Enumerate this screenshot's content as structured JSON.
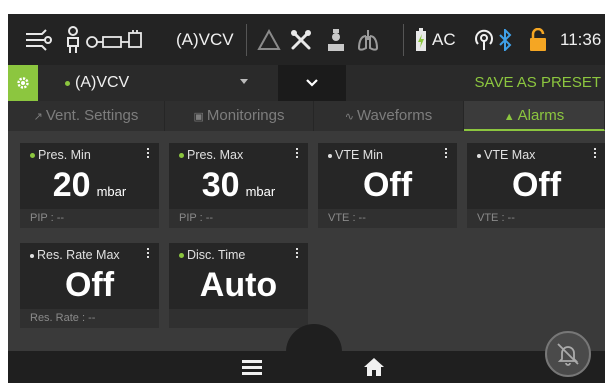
{
  "status": {
    "mode": "(A)VCV",
    "power": "AC",
    "time": "11:36"
  },
  "moderow": {
    "mode_label": "(A)VCV",
    "save_preset": "SAVE AS PRESET"
  },
  "tabs": [
    {
      "label": "Vent. Settings",
      "icon": "wrench-icon"
    },
    {
      "label": "Monitorings",
      "icon": "monitor-icon"
    },
    {
      "label": "Waveforms",
      "icon": "wave-icon"
    },
    {
      "label": "Alarms",
      "icon": "bell-icon"
    }
  ],
  "active_tab": "Alarms",
  "cards": [
    {
      "title": "Pres. Min",
      "value": "20",
      "unit": "mbar",
      "sub": "PIP : --",
      "dot": "green"
    },
    {
      "title": "Pres. Max",
      "value": "30",
      "unit": "mbar",
      "sub": "PIP : --",
      "dot": "green"
    },
    {
      "title": "VTE Min",
      "value": "Off",
      "unit": "",
      "sub": "VTE : --",
      "dot": "white"
    },
    {
      "title": "VTE Max",
      "value": "Off",
      "unit": "",
      "sub": "VTE : --",
      "dot": "white"
    },
    {
      "title": "Res. Rate Max",
      "value": "Off",
      "unit": "",
      "sub": "Res. Rate : --",
      "dot": "white"
    },
    {
      "title": "Disc. Time",
      "value": "Auto",
      "unit": "",
      "sub": "",
      "dot": "green"
    }
  ],
  "colors": {
    "accent": "#8cc63f",
    "background": "#3a3a3a",
    "card": "#262626"
  }
}
